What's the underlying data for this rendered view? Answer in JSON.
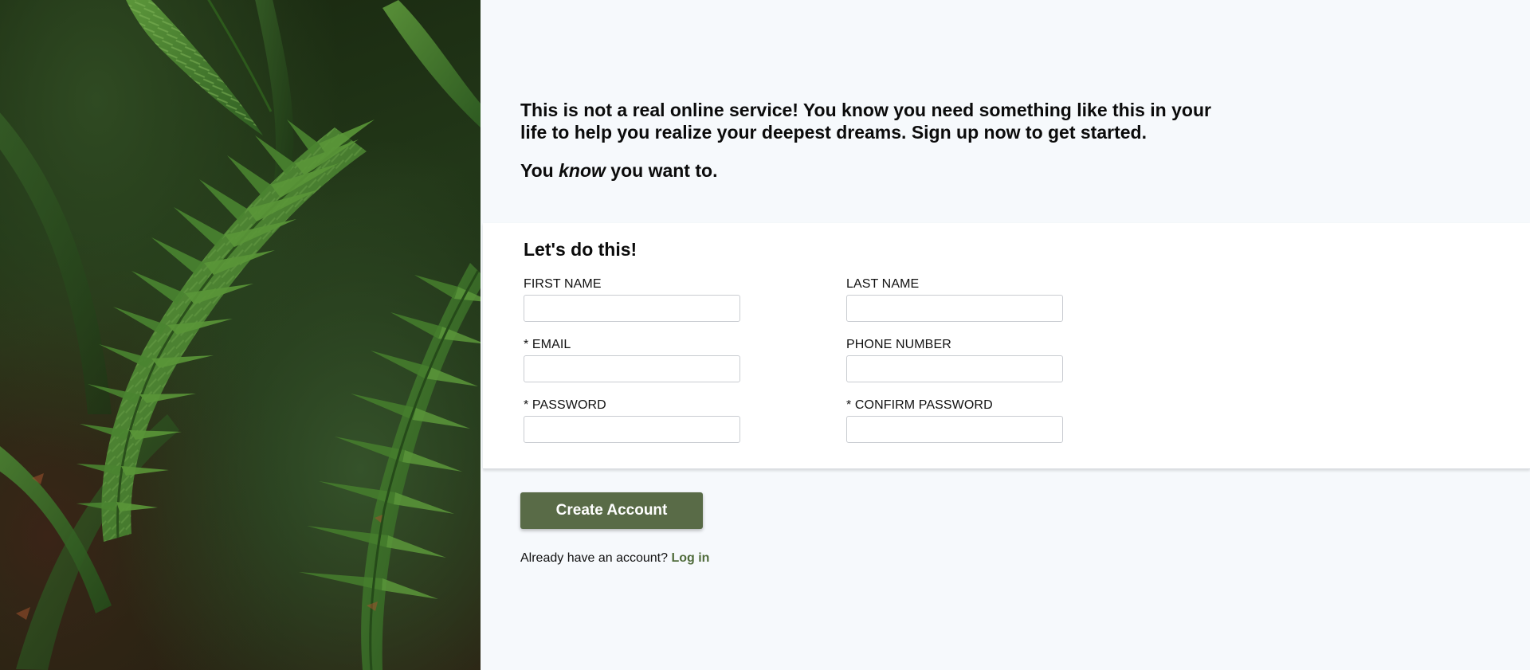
{
  "hero": {
    "image_alt": "fern-photo"
  },
  "intro": {
    "paragraph1": "This is not a real online service! You know you need something like this in your life to help you realize your deepest dreams. Sign up now to get started.",
    "paragraph2_prefix": "You ",
    "paragraph2_emphasis": "know",
    "paragraph2_suffix": " you want to."
  },
  "form": {
    "heading": "Let's do this!",
    "fields": {
      "first_name": {
        "label": "FIRST NAME",
        "value": "",
        "placeholder": ""
      },
      "last_name": {
        "label": "LAST NAME",
        "value": "",
        "placeholder": ""
      },
      "email": {
        "label": "* EMAIL",
        "value": "",
        "placeholder": ""
      },
      "phone": {
        "label": "PHONE NUMBER",
        "value": "",
        "placeholder": ""
      },
      "password": {
        "label": "* PASSWORD",
        "value": "",
        "placeholder": ""
      },
      "confirm_password": {
        "label": "* CONFIRM PASSWORD",
        "value": "",
        "placeholder": ""
      }
    }
  },
  "actions": {
    "create_account_label": "Create Account",
    "login_prompt": "Already have an account?",
    "login_link": "Log in"
  },
  "colors": {
    "accent": "#596b47",
    "link": "#4f6b3a",
    "page_bg": "#f6f9fc",
    "panel_bg": "#ffffff"
  }
}
